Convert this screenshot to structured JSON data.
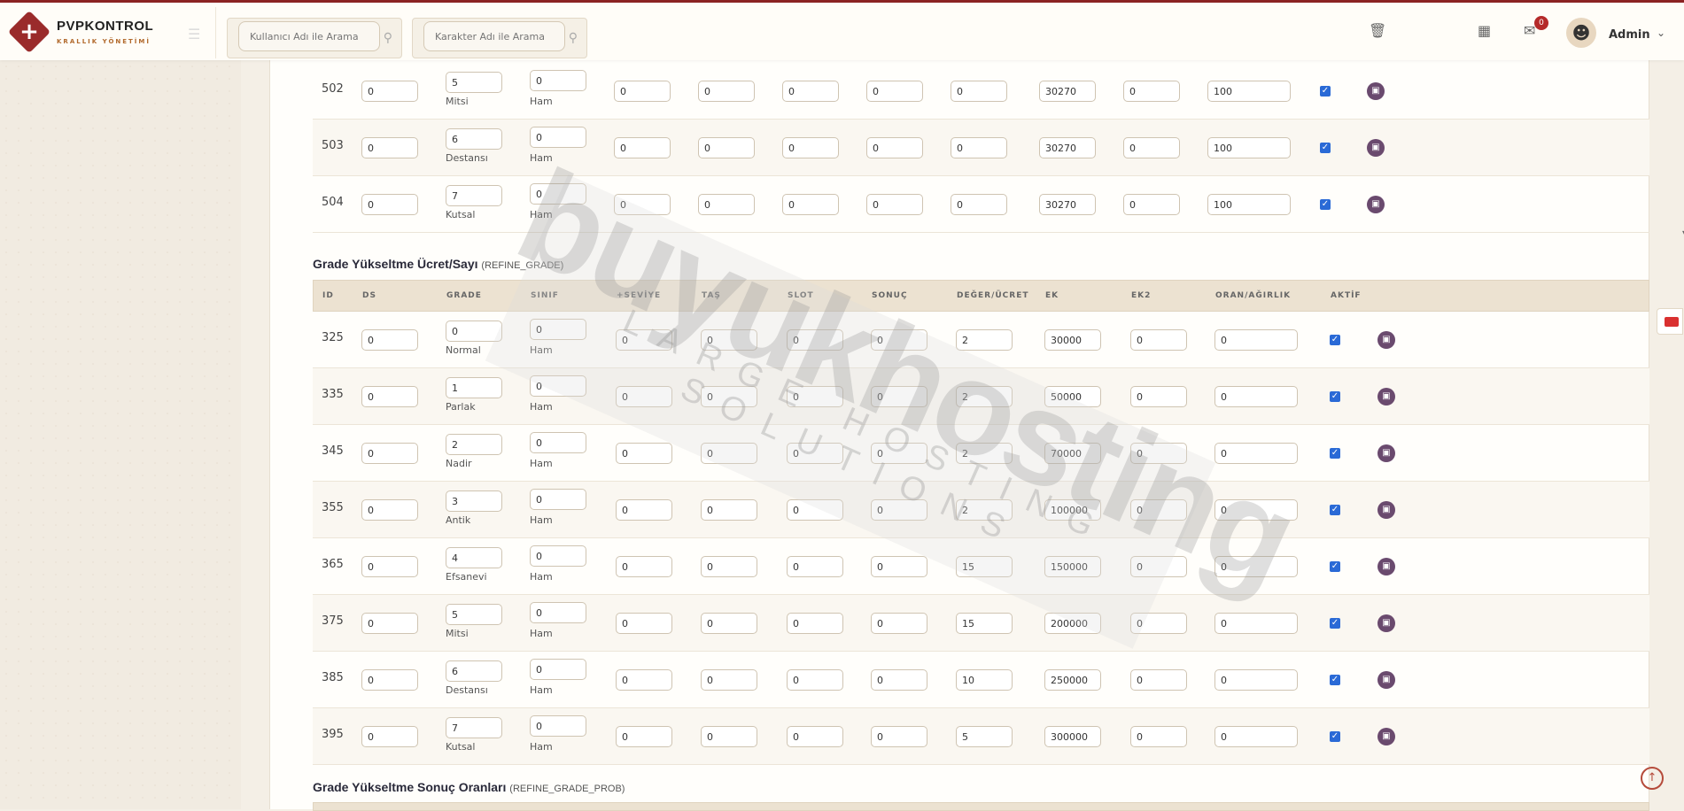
{
  "brand": {
    "title": "PVPKONTROL",
    "subtitle": "KRALLIK YÖNETİMİ"
  },
  "search": {
    "user_placeholder": "Kullanıcı Adı ile Arama",
    "char_placeholder": "Karakter Adı ile Arama"
  },
  "header": {
    "notification_count": "0",
    "admin_name": "Admin"
  },
  "top_table": {
    "rows": [
      {
        "id": "502",
        "ds": "0",
        "grade": "5",
        "grade_label": "Mitsi",
        "sinif": "0",
        "sinif_label": "Ham",
        "seviye": "0",
        "tas": "0",
        "slot": "0",
        "sonuc": "0",
        "deger": "0",
        "ek": "30270",
        "ek2": "0",
        "oran": "100"
      },
      {
        "id": "503",
        "ds": "0",
        "grade": "6",
        "grade_label": "Destansı",
        "sinif": "0",
        "sinif_label": "Ham",
        "seviye": "0",
        "tas": "0",
        "slot": "0",
        "sonuc": "0",
        "deger": "0",
        "ek": "30270",
        "ek2": "0",
        "oran": "100"
      },
      {
        "id": "504",
        "ds": "0",
        "grade": "7",
        "grade_label": "Kutsal",
        "sinif": "0",
        "sinif_label": "Ham",
        "seviye": "0",
        "tas": "0",
        "slot": "0",
        "sonuc": "0",
        "deger": "0",
        "ek": "30270",
        "ek2": "0",
        "oran": "100"
      }
    ]
  },
  "refine_grade": {
    "title": "Grade Yükseltme Ücret/Sayı",
    "code": "(REFINE_GRADE)",
    "headers": [
      "ID",
      "DS",
      "GRADE",
      "SINIF",
      "+SEVİYE",
      "TAŞ",
      "SLOT",
      "SONUÇ",
      "DEĞER/ÜCRET",
      "EK",
      "EK2",
      "ORAN/AĞIRLIK",
      "AKTİF"
    ],
    "rows": [
      {
        "id": "325",
        "ds": "0",
        "grade": "0",
        "grade_label": "Normal",
        "sinif": "0",
        "sinif_label": "Ham",
        "seviye": "0",
        "tas": "0",
        "slot": "0",
        "sonuc": "0",
        "deger": "2",
        "ek": "30000",
        "ek2": "0",
        "oran": "0"
      },
      {
        "id": "335",
        "ds": "0",
        "grade": "1",
        "grade_label": "Parlak",
        "sinif": "0",
        "sinif_label": "Ham",
        "seviye": "0",
        "tas": "0",
        "slot": "0",
        "sonuc": "0",
        "deger": "2",
        "ek": "50000",
        "ek2": "0",
        "oran": "0"
      },
      {
        "id": "345",
        "ds": "0",
        "grade": "2",
        "grade_label": "Nadir",
        "sinif": "0",
        "sinif_label": "Ham",
        "seviye": "0",
        "tas": "0",
        "slot": "0",
        "sonuc": "0",
        "deger": "2",
        "ek": "70000",
        "ek2": "0",
        "oran": "0"
      },
      {
        "id": "355",
        "ds": "0",
        "grade": "3",
        "grade_label": "Antik",
        "sinif": "0",
        "sinif_label": "Ham",
        "seviye": "0",
        "tas": "0",
        "slot": "0",
        "sonuc": "0",
        "deger": "2",
        "ek": "100000",
        "ek2": "0",
        "oran": "0"
      },
      {
        "id": "365",
        "ds": "0",
        "grade": "4",
        "grade_label": "Efsanevi",
        "sinif": "0",
        "sinif_label": "Ham",
        "seviye": "0",
        "tas": "0",
        "slot": "0",
        "sonuc": "0",
        "deger": "15",
        "ek": "150000",
        "ek2": "0",
        "oran": "0"
      },
      {
        "id": "375",
        "ds": "0",
        "grade": "5",
        "grade_label": "Mitsi",
        "sinif": "0",
        "sinif_label": "Ham",
        "seviye": "0",
        "tas": "0",
        "slot": "0",
        "sonuc": "0",
        "deger": "15",
        "ek": "200000",
        "ek2": "0",
        "oran": "0"
      },
      {
        "id": "385",
        "ds": "0",
        "grade": "6",
        "grade_label": "Destansı",
        "sinif": "0",
        "sinif_label": "Ham",
        "seviye": "0",
        "tas": "0",
        "slot": "0",
        "sonuc": "0",
        "deger": "10",
        "ek": "250000",
        "ek2": "0",
        "oran": "0"
      },
      {
        "id": "395",
        "ds": "0",
        "grade": "7",
        "grade_label": "Kutsal",
        "sinif": "0",
        "sinif_label": "Ham",
        "seviye": "0",
        "tas": "0",
        "slot": "0",
        "sonuc": "0",
        "deger": "5",
        "ek": "300000",
        "ek2": "0",
        "oran": "0"
      }
    ]
  },
  "refine_grade_prob": {
    "title": "Grade Yükseltme Sonuç Oranları",
    "code": "(REFINE_GRADE_PROB)"
  },
  "watermark": {
    "main": "buyukhosting",
    "sub": "LARGE HOSTING SOLUTIONS"
  },
  "colors": {
    "accent": "#9a2b2b",
    "save_button": "#6a4a6e",
    "checkbox": "#2a6ad6",
    "header_bg": "#ece2d1"
  }
}
